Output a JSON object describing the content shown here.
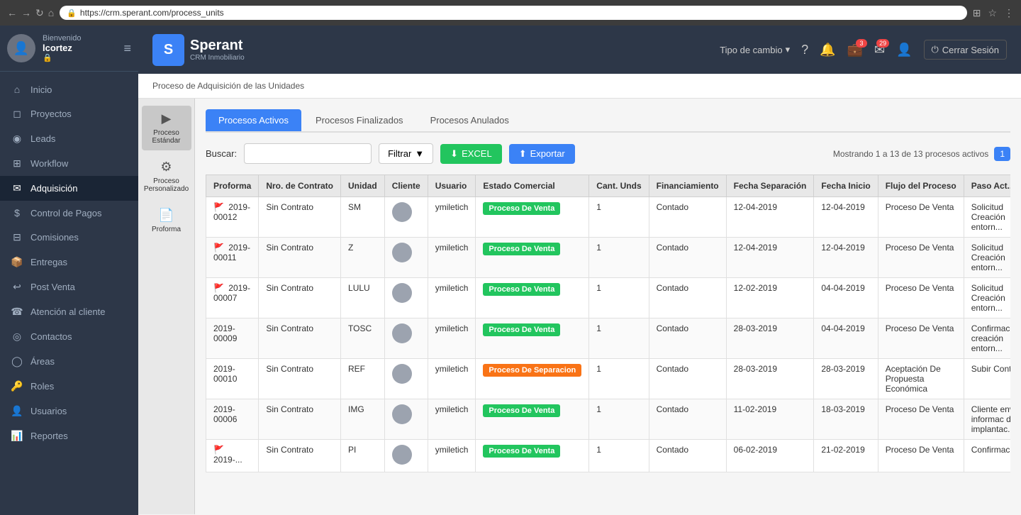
{
  "browser": {
    "back": "←",
    "forward": "→",
    "refresh": "↻",
    "home": "⌂",
    "url": "https://crm.sperant.com/process_units",
    "lock": "🔒"
  },
  "header": {
    "logo_letter": "S",
    "brand": "Sperant",
    "sub": "CRM Inmobiliario",
    "tipo_cambio": "Tipo de cambio",
    "help": "?",
    "badge_briefcase": "3",
    "badge_mail": "29",
    "cerrar_sesion": "Cerrar Sesión"
  },
  "sidebar": {
    "welcome": "Bienvenido",
    "username": "lcortez",
    "items": [
      {
        "id": "inicio",
        "label": "Inicio",
        "icon": "⌂"
      },
      {
        "id": "proyectos",
        "label": "Proyectos",
        "icon": "◻"
      },
      {
        "id": "leads",
        "label": "Leads",
        "icon": "◉"
      },
      {
        "id": "workflow",
        "label": "Workflow",
        "icon": "⊞"
      },
      {
        "id": "adquisicion",
        "label": "Adquisición",
        "icon": "✉",
        "active": true
      },
      {
        "id": "control-pagos",
        "label": "Control de Pagos",
        "icon": "$"
      },
      {
        "id": "comisiones",
        "label": "Comisiones",
        "icon": "⊟"
      },
      {
        "id": "entregas",
        "label": "Entregas",
        "icon": "📦"
      },
      {
        "id": "post-venta",
        "label": "Post Venta",
        "icon": "↩"
      },
      {
        "id": "atencion-cliente",
        "label": "Atención al cliente",
        "icon": "☎"
      },
      {
        "id": "contactos",
        "label": "Contactos",
        "icon": "◎"
      },
      {
        "id": "areas",
        "label": "Áreas",
        "icon": "◯"
      },
      {
        "id": "roles",
        "label": "Roles",
        "icon": "🔑"
      },
      {
        "id": "usuarios",
        "label": "Usuarios",
        "icon": "👤"
      },
      {
        "id": "reportes",
        "label": "Reportes",
        "icon": "📊"
      }
    ]
  },
  "breadcrumb": "Proceso de Adquisición de las Unidades",
  "process_sidebar": [
    {
      "id": "proceso-estandar",
      "label": "Proceso Estándar",
      "icon": "▶",
      "active": true
    },
    {
      "id": "proceso-personalizado",
      "label": "Proceso Personalizado",
      "icon": "⚙"
    },
    {
      "id": "proforma",
      "label": "Proforma",
      "icon": "📄"
    }
  ],
  "tabs": [
    {
      "id": "activos",
      "label": "Procesos Activos",
      "active": true
    },
    {
      "id": "finalizados",
      "label": "Procesos Finalizados",
      "active": false
    },
    {
      "id": "anulados",
      "label": "Procesos Anulados",
      "active": false
    }
  ],
  "controls": {
    "search_label": "Buscar:",
    "search_placeholder": "",
    "filter_label": "Filtrar",
    "excel_label": "EXCEL",
    "export_label": "Exportar",
    "pagination_info": "Mostrando 1 a 13 de 13 procesos activos",
    "page_num": "1"
  },
  "table": {
    "headers": [
      "Proforma",
      "Nro. de Contrato",
      "Unidad",
      "Cliente",
      "Usuario",
      "Estado Comercial",
      "Cant. Unds",
      "Financiamiento",
      "Fecha Separación",
      "Fecha Inicio",
      "Flujo del Proceso",
      "Paso Act..."
    ],
    "rows": [
      {
        "proforma": "2019-00012",
        "flag": true,
        "contrato": "Sin Contrato",
        "unidad": "SM",
        "usuario": "ymiletich",
        "estado": "Proceso De Venta",
        "estado_type": "venta",
        "cant": "1",
        "financiamiento": "Contado",
        "fecha_sep": "12-04-2019",
        "fecha_ini": "12-04-2019",
        "flujo": "Proceso De Venta",
        "paso": "Solicitud Creación entorn..."
      },
      {
        "proforma": "2019-00011",
        "flag": true,
        "contrato": "Sin Contrato",
        "unidad": "Z",
        "usuario": "ymiletich",
        "estado": "Proceso De Venta",
        "estado_type": "venta",
        "cant": "1",
        "financiamiento": "Contado",
        "fecha_sep": "12-04-2019",
        "fecha_ini": "12-04-2019",
        "flujo": "Proceso De Venta",
        "paso": "Solicitud Creación entorn..."
      },
      {
        "proforma": "2019-00007",
        "flag": true,
        "contrato": "Sin Contrato",
        "unidad": "LULU",
        "usuario": "ymiletich",
        "estado": "Proceso De Venta",
        "estado_type": "venta",
        "cant": "1",
        "financiamiento": "Contado",
        "fecha_sep": "12-02-2019",
        "fecha_ini": "04-04-2019",
        "flujo": "Proceso De Venta",
        "paso": "Solicitud Creación entorn..."
      },
      {
        "proforma": "2019-00009",
        "flag": false,
        "contrato": "Sin Contrato",
        "unidad": "TOSC",
        "usuario": "ymiletich",
        "estado": "Proceso De Venta",
        "estado_type": "venta",
        "cant": "1",
        "financiamiento": "Contado",
        "fecha_sep": "28-03-2019",
        "fecha_ini": "04-04-2019",
        "flujo": "Proceso De Venta",
        "paso": "Confirmación creación entorn..."
      },
      {
        "proforma": "2019-00010",
        "flag": false,
        "contrato": "Sin Contrato",
        "unidad": "REF",
        "usuario": "ymiletich",
        "estado": "Proceso De Separacion",
        "estado_type": "separacion",
        "cant": "1",
        "financiamiento": "Contado",
        "fecha_sep": "28-03-2019",
        "fecha_ini": "28-03-2019",
        "flujo": "Aceptación De Propuesta Económica",
        "paso": "Subir Cont..."
      },
      {
        "proforma": "2019-00006",
        "flag": false,
        "contrato": "Sin Contrato",
        "unidad": "IMG",
        "usuario": "ymiletich",
        "estado": "Proceso De Venta",
        "estado_type": "venta",
        "cant": "1",
        "financiamiento": "Contado",
        "fecha_sep": "11-02-2019",
        "fecha_ini": "18-03-2019",
        "flujo": "Proceso De Venta",
        "paso": "Cliente env informac del implantac..."
      },
      {
        "proforma": "2019-...",
        "flag": true,
        "contrato": "Sin Contrato",
        "unidad": "PI",
        "usuario": "ymiletich",
        "estado": "Proceso De Venta",
        "estado_type": "venta",
        "cant": "1",
        "financiamiento": "Contado",
        "fecha_sep": "06-02-2019",
        "fecha_ini": "21-02-2019",
        "flujo": "Proceso De Venta",
        "paso": "Confirmac..."
      }
    ]
  }
}
